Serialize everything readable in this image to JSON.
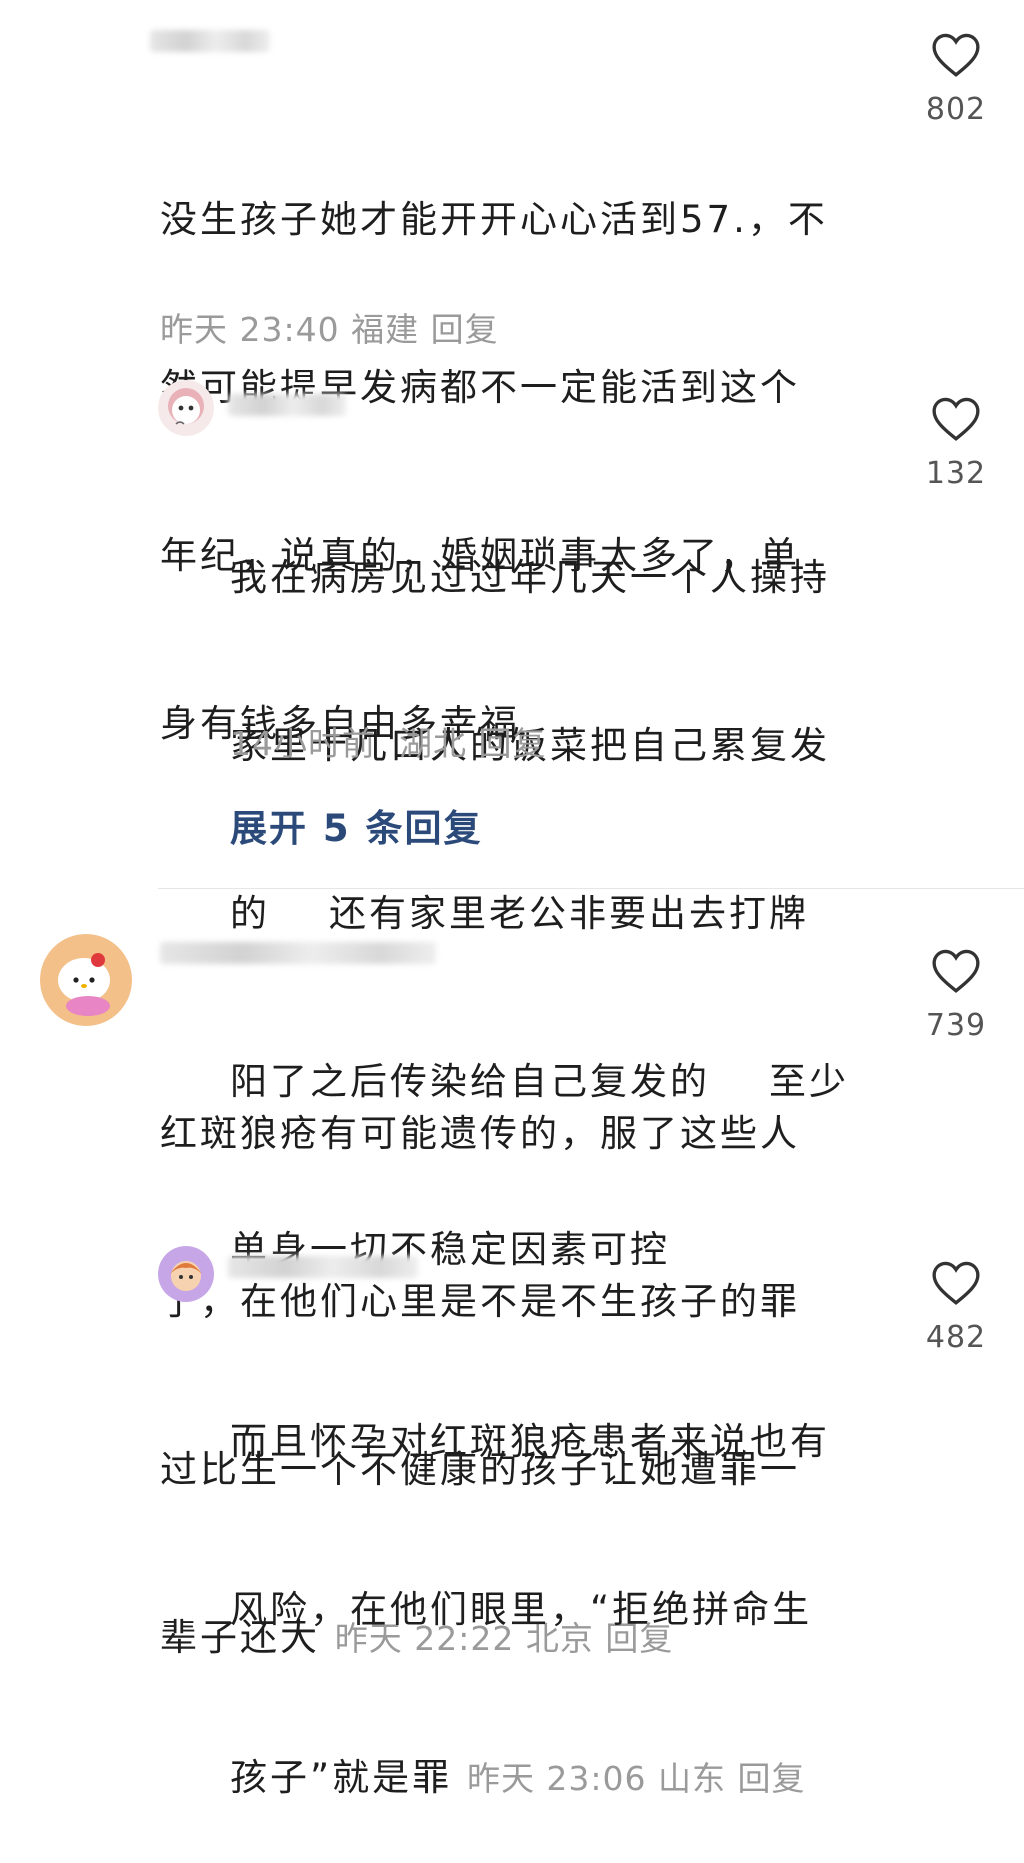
{
  "comments": [
    {
      "text_lines": [
        "没生孩子她才能开开心心活到57.，不",
        "然可能提早发病都不一定能活到这个",
        "年纪，说真的，婚姻琐事太多了，单",
        "身有钱多自由多幸福"
      ],
      "meta": "昨天 23:40 福建 回复",
      "likes": "802"
    },
    {
      "text_lines": [
        "我在病房见过过年几天一个人操持",
        "家里十几口人的饭菜把自己累复发",
        "的    还有家里老公非要出去打牌",
        "阳了之后传染给自己复发的    至少",
        "单身一切不稳定因素可控"
      ],
      "meta": "14小时前  湖北 回复",
      "likes": "132"
    },
    {
      "text_lines": [
        "红斑狼疮有可能遗传的，服了这些人",
        "了，在他们心里是不是不生孩子的罪",
        "过比生一个不健康的孩子让她遭罪一"
      ],
      "last_line_text": "辈子还大",
      "meta": "昨天 22:22 北京 回复",
      "likes": "739"
    },
    {
      "text_lines": [
        "而且怀孕对红斑狼疮患者来说也有",
        "风险，在他们眼里，“拒绝拼命生"
      ],
      "last_line_text": "孩子”就是罪",
      "meta": "昨天 23:06 山东 回复",
      "likes": "482"
    }
  ],
  "expand_replies": "展开 5 条回复",
  "colors": {
    "text": "#1e1e1e",
    "meta": "#9a9a9a",
    "expand": "#2b4a7a"
  }
}
